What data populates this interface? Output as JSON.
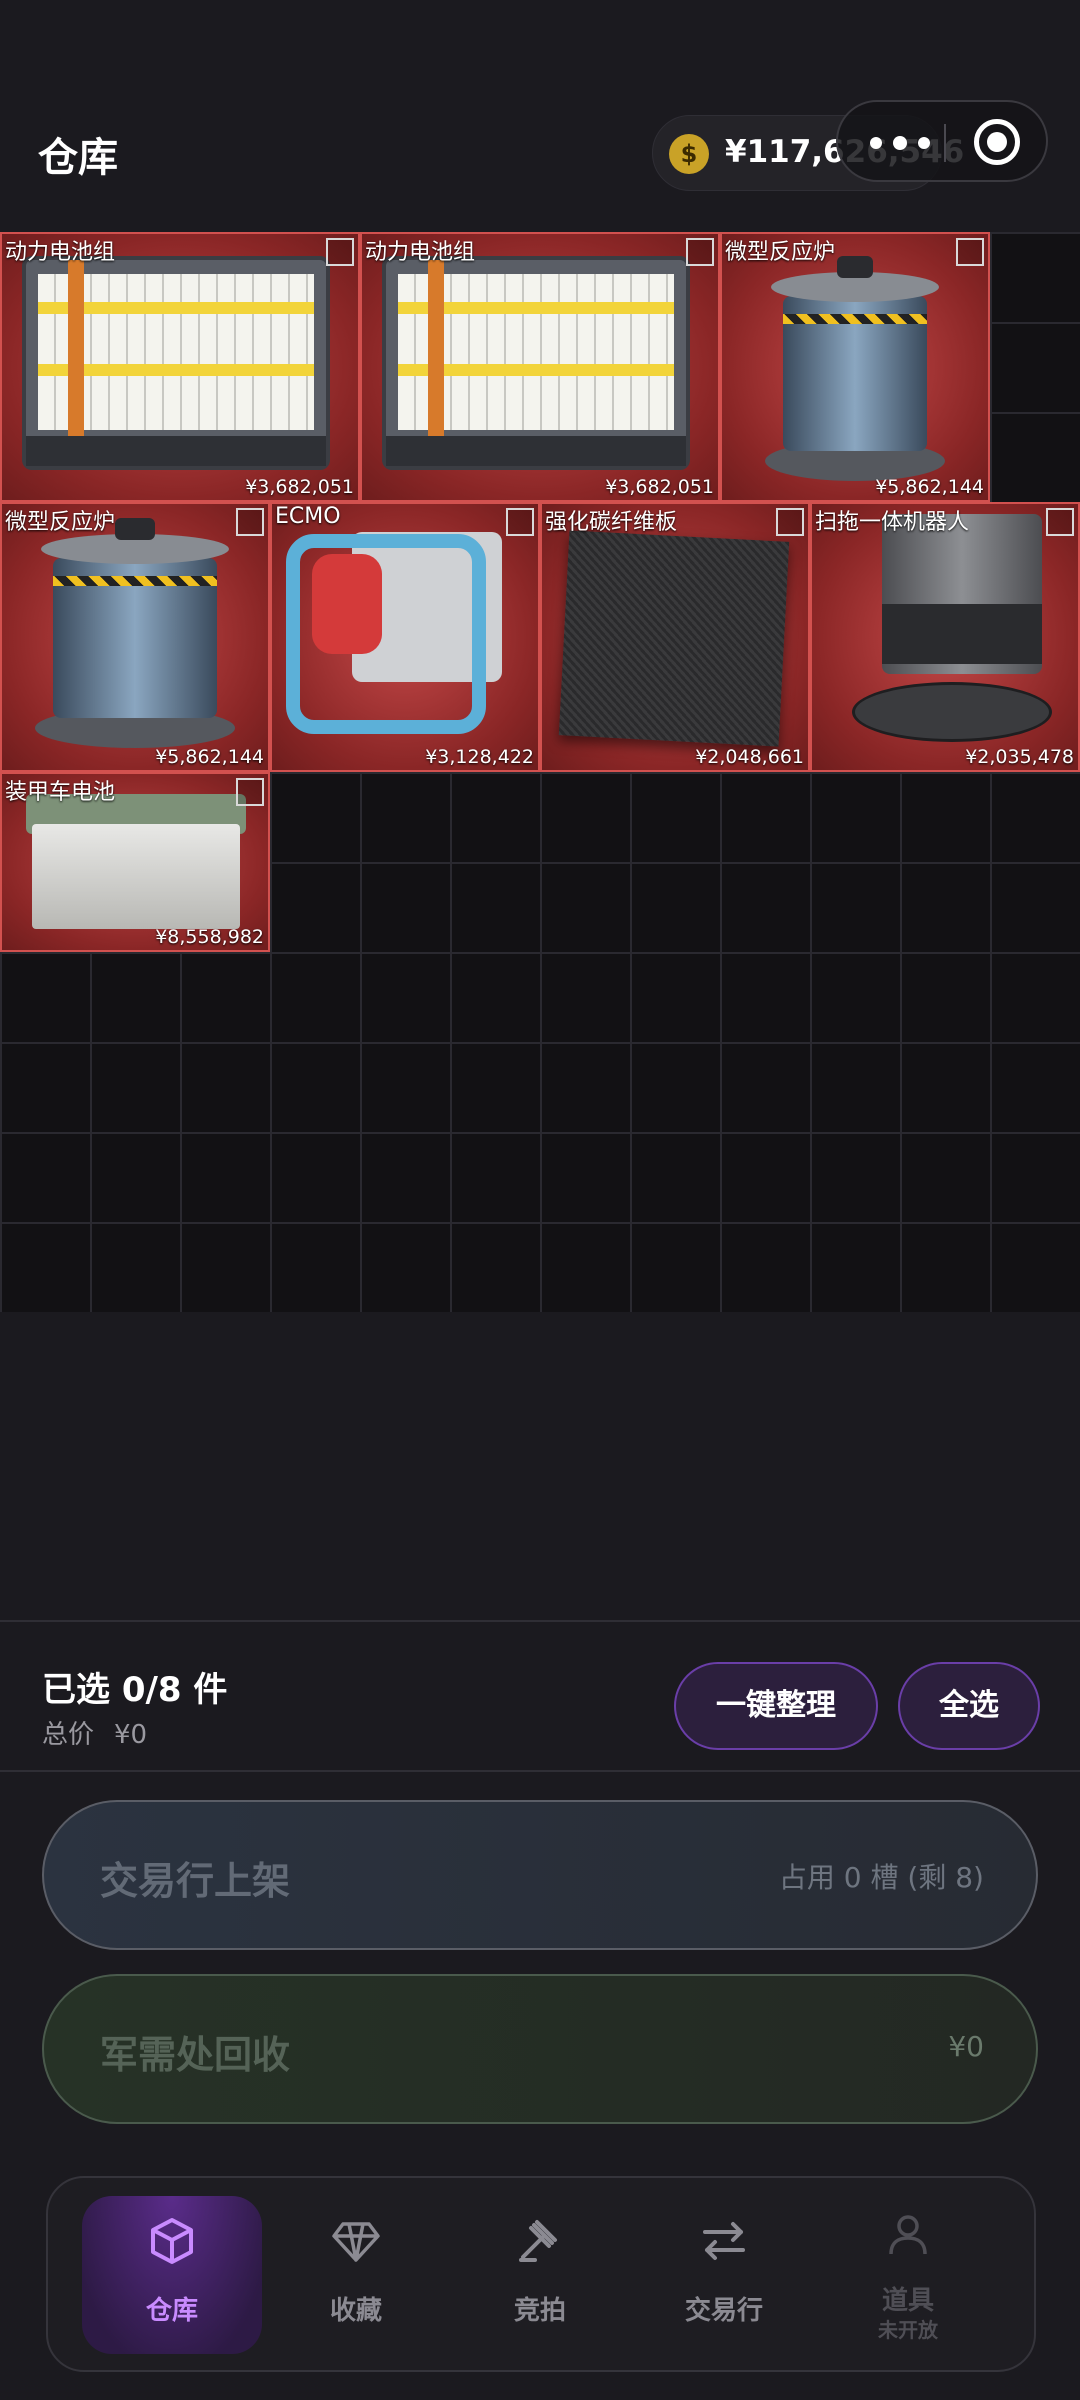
{
  "header": {
    "title": "仓库",
    "coin_symbol": "$",
    "balance": "¥117,626,546"
  },
  "inventory": {
    "items": [
      {
        "name": "动力电池组",
        "price": "¥3,682,051",
        "art": "battery"
      },
      {
        "name": "动力电池组",
        "price": "¥3,682,051",
        "art": "battery"
      },
      {
        "name": "微型反应炉",
        "price": "¥5,862,144",
        "art": "reactor"
      },
      {
        "name": "微型反应炉",
        "price": "¥5,862,144",
        "art": "reactor"
      },
      {
        "name": "ECMO",
        "price": "¥3,128,422",
        "art": "ecmo"
      },
      {
        "name": "强化碳纤维板",
        "price": "¥2,048,661",
        "art": "carbon"
      },
      {
        "name": "扫拖一体机器人",
        "price": "¥2,035,478",
        "art": "robot"
      },
      {
        "name": "装甲车电池",
        "price": "¥8,558,982",
        "art": "armored-battery"
      }
    ]
  },
  "selection": {
    "summary": "已选 0/8 件",
    "total_label": "总价",
    "total_value": "¥0",
    "organize_label": "一键整理",
    "select_all_label": "全选"
  },
  "actions": {
    "market_label": "交易行上架",
    "market_info": "占用 0 槽 (剩 8)",
    "recycle_label": "军需处回收",
    "recycle_value": "¥0"
  },
  "tabs": [
    {
      "label": "仓库",
      "icon": "box-icon",
      "active": true
    },
    {
      "label": "收藏",
      "icon": "diamond-icon"
    },
    {
      "label": "竞拍",
      "icon": "gavel-icon"
    },
    {
      "label": "交易行",
      "icon": "swap-icon"
    },
    {
      "label": "道具",
      "sublabel": "未开放",
      "icon": "person-icon",
      "disabled": true
    }
  ],
  "colors": {
    "accent": "#c98bff",
    "item_bg": "#a43434",
    "item_border": "#d2514f"
  }
}
